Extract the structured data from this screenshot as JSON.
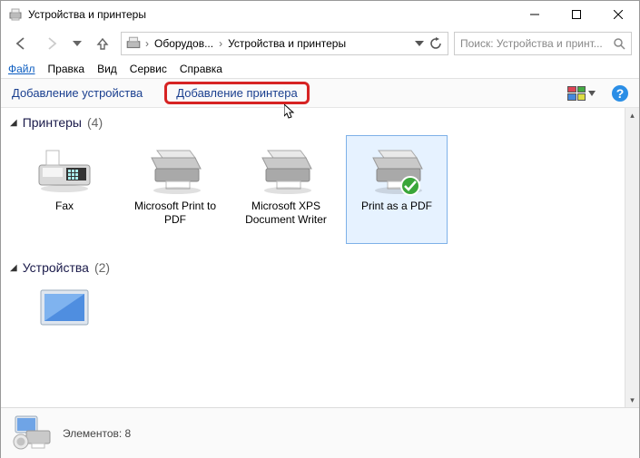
{
  "window_title": "Устройства и принтеры",
  "breadcrumb": {
    "seg1": "Оборудов...",
    "seg2": "Устройства и принтеры"
  },
  "search": {
    "placeholder": "Поиск: Устройства и принт..."
  },
  "menu": {
    "file": "Файл",
    "edit": "Правка",
    "view": "Вид",
    "tools": "Сервис",
    "help": "Справка"
  },
  "toolbar": {
    "add_device": "Добавление устройства",
    "add_printer": "Добавление принтера"
  },
  "groups": {
    "printers": {
      "label": "Принтеры",
      "count": "(4)"
    },
    "devices": {
      "label": "Устройства",
      "count": "(2)"
    }
  },
  "items": {
    "fax": "Fax",
    "ms_print_pdf": "Microsoft Print to PDF",
    "ms_xps": "Microsoft XPS Document Writer",
    "print_as_pdf": "Print as a PDF"
  },
  "status": {
    "label": "Элементов:",
    "count": "8"
  }
}
